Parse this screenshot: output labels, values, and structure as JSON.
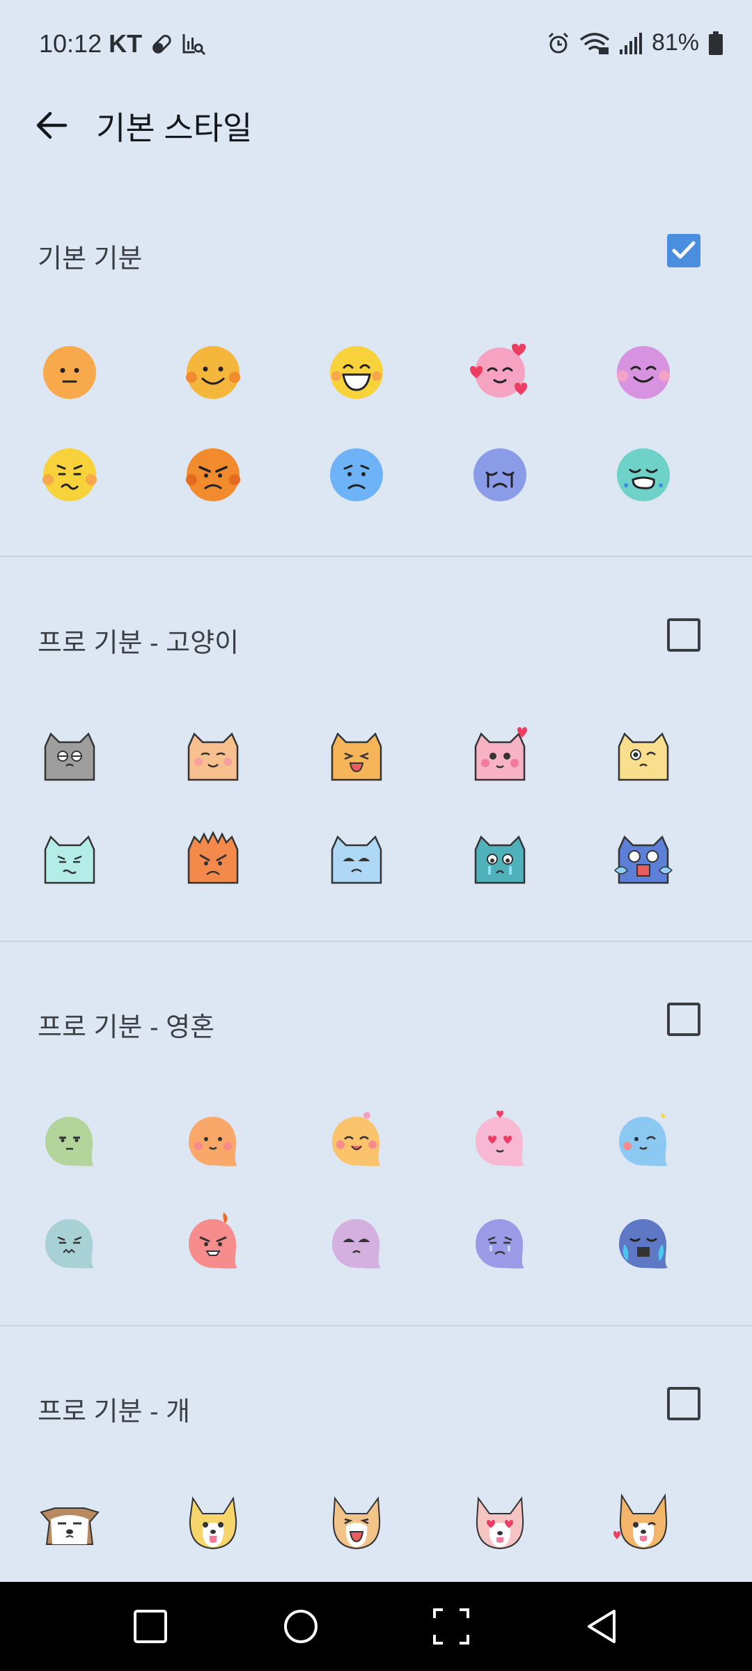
{
  "status": {
    "time": "10:12",
    "carrier": "KT",
    "battery": "81%"
  },
  "header": {
    "title": "기본 스타일",
    "back_icon": "arrow-left-icon"
  },
  "sections": [
    {
      "title": "기본 기분",
      "checked": true
    },
    {
      "title": "프로 기분 - 고양이",
      "checked": false
    },
    {
      "title": "프로 기분 - 영혼",
      "checked": false
    },
    {
      "title": "프로 기분 - 개",
      "checked": false
    }
  ],
  "colors": {
    "background": "#dde7f3",
    "checkbox_checked": "#4a8ee0",
    "smiley_row1": [
      "#f7a94b",
      "#f4b73c",
      "#f7d23a",
      "#f5a3c0",
      "#d792e0"
    ],
    "smiley_row2": [
      "#f7d23a",
      "#f28a2e",
      "#6eb3f7",
      "#8a9be8",
      "#6fd2c8"
    ],
    "cat_row1": [
      "#9e9e9e",
      "#f9c08f",
      "#f7b55a",
      "#f7b3c4",
      "#f9df8d"
    ],
    "cat_row2": [
      "#b4ede8",
      "#f38a4c",
      "#aed8f5",
      "#4fb2ba",
      "#5c7fd8"
    ],
    "ghost_row1": [
      "#b3d49a",
      "#f9a86a",
      "#fbc36c",
      "#f9b8d2",
      "#8cc9f2"
    ],
    "ghost_row2": [
      "#a8d1d6",
      "#f78c8c",
      "#d3b0df",
      "#9a9ae6",
      "#5f78c6"
    ],
    "dog_row1": [
      "#f1e4d6",
      "#f6d56a",
      "#f3c489",
      "#f7c4c4",
      "#f3b56a"
    ]
  },
  "nav": {
    "recents_icon": "square-icon",
    "home_icon": "circle-icon",
    "screenshot_icon": "screenshot-frame-icon",
    "back_icon": "triangle-back-icon"
  }
}
